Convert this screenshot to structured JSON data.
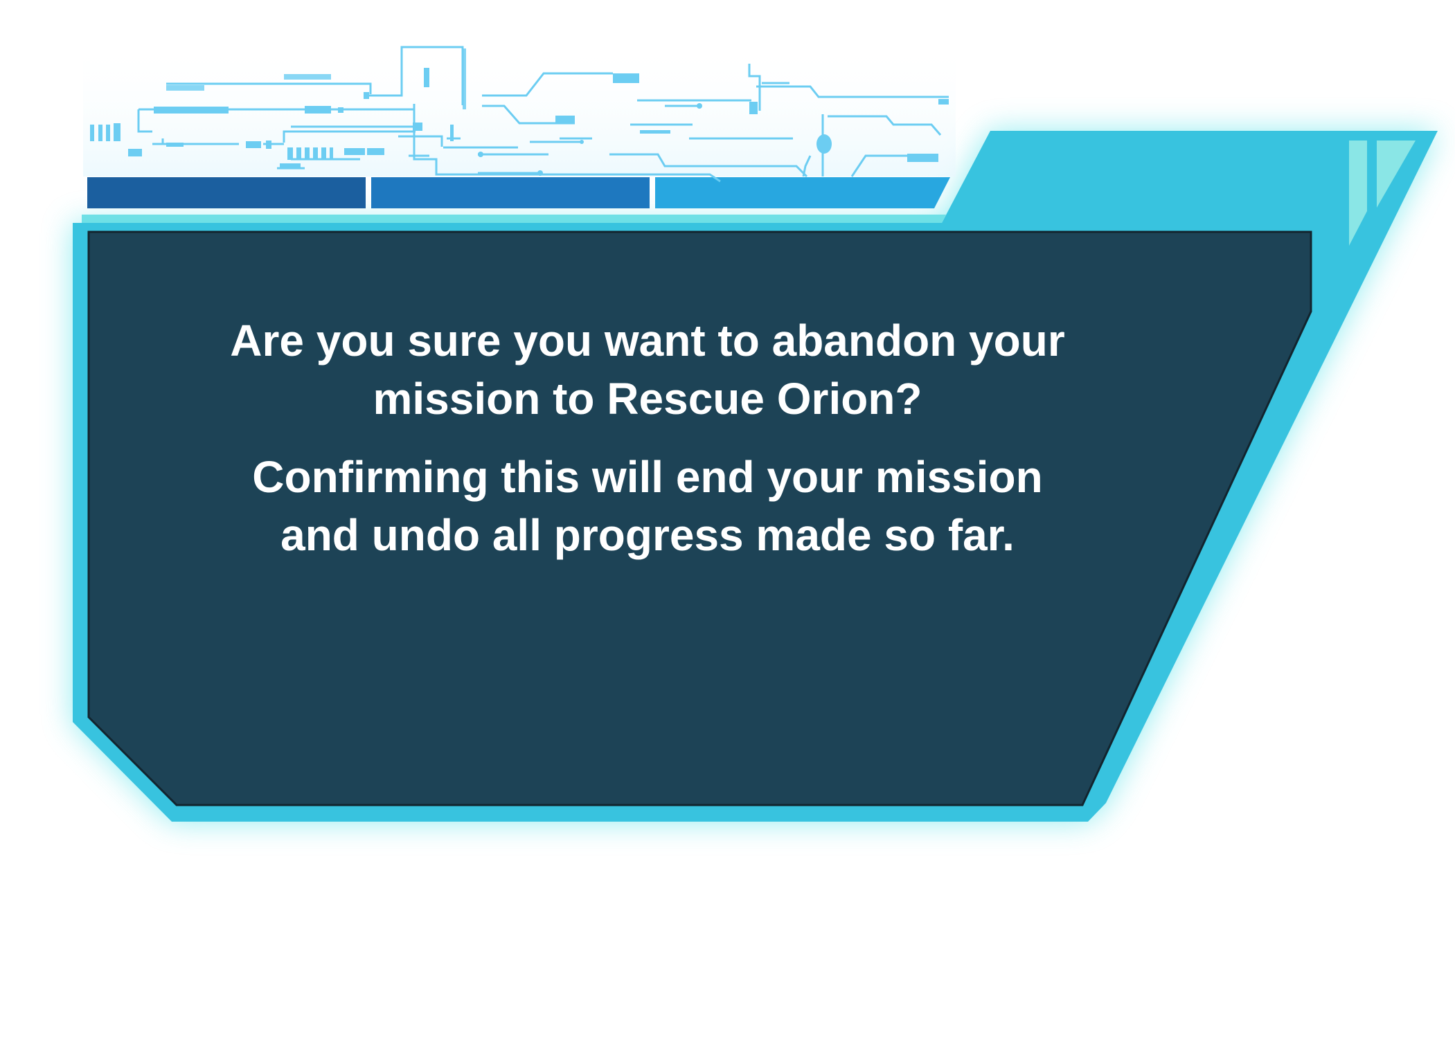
{
  "dialog": {
    "question_line_1": "Are you sure you want to abandon your",
    "question_line_2": "mission to Rescue Orion?",
    "warning_line_1": "Confirming this will end your mission",
    "warning_line_2": "and undo all progress made so far."
  },
  "colors": {
    "panel_fill": "#1d4356",
    "frame_cyan": "#38c3df",
    "glow": "#6fe6ec",
    "tab_dark": "#1b5f9f",
    "tab_mid": "#1e78bf",
    "tab_light": "#28a7e0",
    "circuit": "#6ccdf2",
    "text": "#ffffff"
  }
}
